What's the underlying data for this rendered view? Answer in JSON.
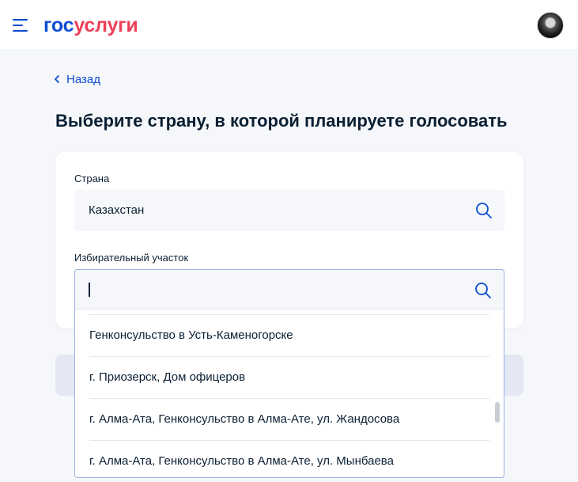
{
  "header": {
    "logo_part1": "гос",
    "logo_part2": "услуги",
    "brand_color": "#0d4cd3",
    "accent_color": "#ee3f58"
  },
  "nav": {
    "back_label": "Назад"
  },
  "page": {
    "title": "Выберите страну, в которой планируете голосовать"
  },
  "form": {
    "country": {
      "label": "Страна",
      "value": "Казахстан"
    },
    "station": {
      "label": "Избирательный участок",
      "value": "",
      "placeholder": ""
    }
  },
  "dropdown": {
    "options": [
      "Генконсульство в Усть-Каменогорске",
      "г. Приозерск, Дом офицеров",
      "г. Алма-Ата, Генконсульство в Алма-Ате, ул. Жандосова",
      "г. Алма-Ата, Генконсульство в Алма-Ате, ул. Мынбаева"
    ]
  },
  "icons": {
    "menu": "menu-icon",
    "search": "search-icon",
    "back": "chevron-left-icon",
    "avatar": "avatar"
  }
}
